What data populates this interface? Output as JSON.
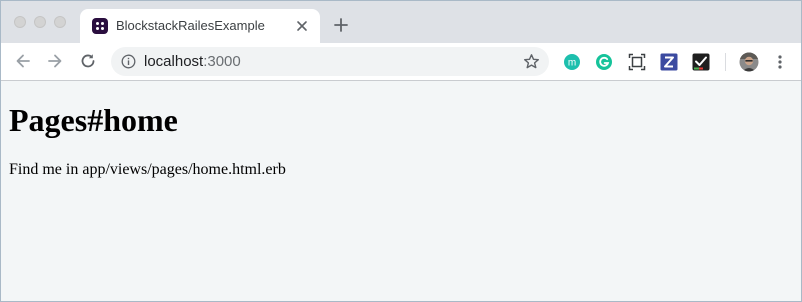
{
  "browser": {
    "tab": {
      "title": "BlockstackRailesExample",
      "favicon_icon": "blockstack-logo-icon"
    },
    "address_bar": {
      "host": "localhost",
      "port": ":3000"
    },
    "extensions": [
      {
        "icon": "mention-extension-icon",
        "color": "#1dbfad"
      },
      {
        "icon": "grammarly-extension-icon",
        "color": "#15c39a"
      },
      {
        "icon": "screenshot-extension-icon",
        "color": "#3c4043"
      },
      {
        "icon": "zotero-extension-icon",
        "color": "#3b4aa0"
      },
      {
        "icon": "todo-check-extension-icon",
        "color": "#1f1f1f"
      }
    ],
    "colors": {
      "tabstrip": "#dee1e6",
      "page_background": "#f3f6f7"
    }
  },
  "page": {
    "heading": "Pages#home",
    "body": "Find me in app/views/pages/home.html.erb"
  }
}
